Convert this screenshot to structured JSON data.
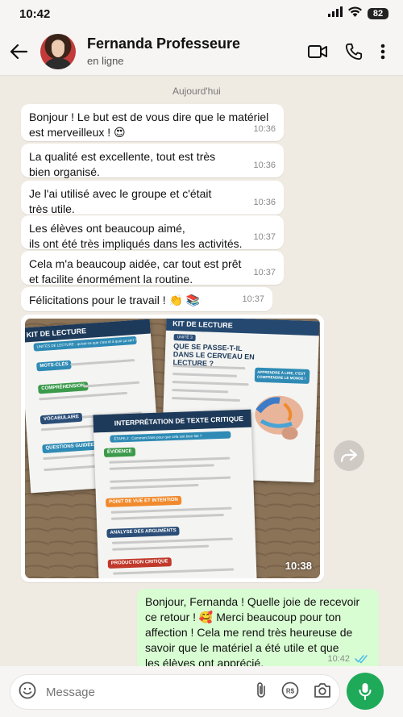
{
  "status_bar": {
    "time": "10:42",
    "battery": "82"
  },
  "contact": {
    "name": "Fernanda Professeure",
    "presence": "en ligne"
  },
  "chat": {
    "date_separator": "Aujourd'hui",
    "messages": [
      {
        "text": "Bonjour ! Le but est de vous dire que le matériel\nest merveilleux ! 😍",
        "time": "10:36"
      },
      {
        "text": "La qualité est excellente, tout est très\nbien organisé.",
        "time": "10:36"
      },
      {
        "text": "Je l'ai utilisé avec le groupe et c'était\ntrès utile.",
        "time": "10:36"
      },
      {
        "text": "Les élèves ont beaucoup aimé,\nils ont été très impliqués dans les activités.",
        "time": "10:37"
      },
      {
        "text": "Cela m'a beaucoup aidée, car tout est prêt\net facilite énormément la routine.",
        "time": "10:37"
      },
      {
        "text": "Félicitations pour le travail ! 👏 📚",
        "time": "10:37"
      }
    ],
    "photo": {
      "time": "10:38",
      "sheet_left": {
        "title": "KIT DE LECTURE",
        "subtitle": "UNITÉS DE LECTURE : qu'est-ce que c'est et à quoi ça sert ?",
        "items": [
          "MOTS-CLÉS",
          "COMPRÉHENSION",
          "VOCABULAIRE",
          "QUESTIONS GUIDÉES"
        ]
      },
      "sheet_right": {
        "title": "KIT DE LECTURE",
        "unit": "UNITÉ 3",
        "heading": "QUE SE PASSE-T-IL DANS LE CERVEAU EN LECTURE ?",
        "callout": "APPRENDRE À LIRE, C'EST COMPRENDRE LE MONDE !"
      },
      "sheet_center": {
        "title": "INTERPRÉTATION DE TEXTE CRITIQUE",
        "step": "ÉTAPE 2 : Comment faire pour que cela soit bien fait ?",
        "sections": [
          "ÉVIDENCE",
          "POINT DE VUE ET INTENTION",
          "ANALYSE DES ARGUMENTS",
          "PRODUCTION CRITIQUE"
        ]
      }
    },
    "outgoing": {
      "text": "Bonjour, Fernanda ! Quelle joie de recevoir\nce retour ! 🥰 Merci beaucoup pour ton\naffection ! Cela me rend très heureuse de\nsavoir que le matériel a été utile et que\nles élèves ont apprécié.\nJe compte toujours sur toi ! 💚 📚",
      "time": "10:42"
    }
  },
  "composer": {
    "placeholder": "Message"
  },
  "colors": {
    "accent": "#1faa59",
    "outgoing_bubble": "#d9fdd3",
    "chat_background": "#efeae2",
    "read_ticks": "#53bdeb"
  },
  "icons": [
    "signal-icon",
    "wifi-icon",
    "battery-icon",
    "back-arrow-icon",
    "video-call-icon",
    "phone-icon",
    "more-vert-icon",
    "forward-icon",
    "emoji-icon",
    "attach-icon",
    "payment-icon",
    "camera-icon",
    "mic-icon",
    "double-check-icon"
  ]
}
